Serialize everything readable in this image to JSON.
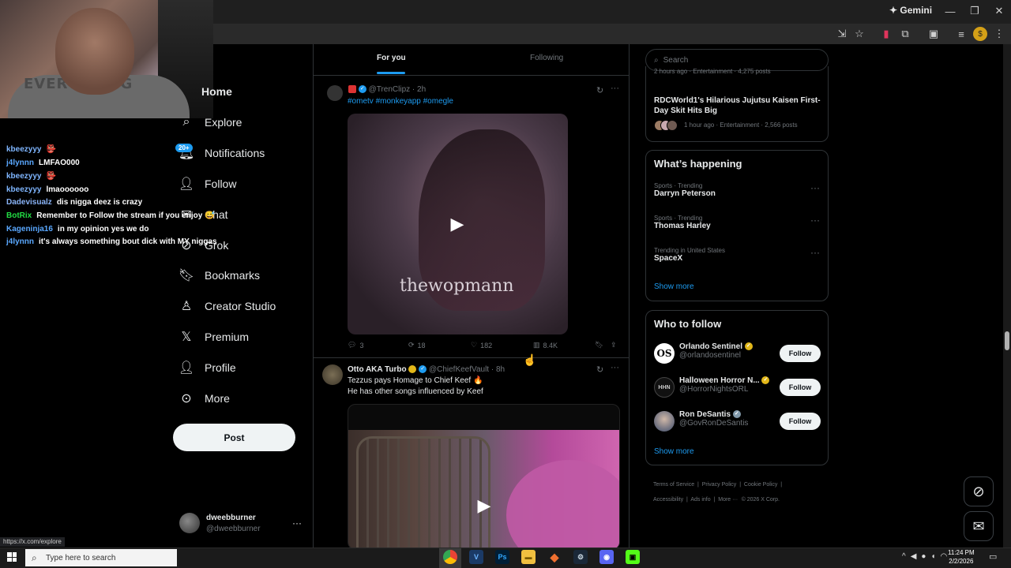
{
  "browser": {
    "gemini_label": "Gemini",
    "status_url": "https://x.com/explore"
  },
  "webcam": {
    "shirt_text": "EVERYTHING"
  },
  "chat": [
    {
      "user": "kbeezyyy",
      "color": "#7fb6ff",
      "message": "👺"
    },
    {
      "user": "j4lynnn",
      "color": "#5aa8ff",
      "message": "LMFAO000"
    },
    {
      "user": "kbeezyyy",
      "color": "#7fb6ff",
      "message": "👺"
    },
    {
      "user": "kbeezyyy",
      "color": "#7fb6ff",
      "message": "lmaoooooo"
    },
    {
      "user": "Dadevisualz",
      "color": "#8ab4f8",
      "message": "dis nigga deez is crazy"
    },
    {
      "user": "BotRix",
      "color": "#22dd44",
      "message": "Remember to Follow the stream if you enjoy 😅"
    },
    {
      "user": "Kageninja16",
      "color": "#5aa8ff",
      "message": "in my opinion yes we do"
    },
    {
      "user": "j4lynnn",
      "color": "#5aa8ff",
      "message": "it's always something bout dick with MY niggas"
    }
  ],
  "nav": {
    "home": "Home",
    "explore": "Explore",
    "notifications": "Notifications",
    "notifications_badge": "20+",
    "follow": "Follow",
    "chat": "Chat",
    "grok": "Grok",
    "bookmarks": "Bookmarks",
    "creator_studio": "Creator Studio",
    "premium": "Premium",
    "profile": "Profile",
    "more": "More",
    "post_button": "Post"
  },
  "account": {
    "name": "dweebburner",
    "handle": "@dweebburner",
    "more": "···"
  },
  "tabs": {
    "for_you": "For you",
    "following": "Following"
  },
  "post1": {
    "handle": "@TrenClipz",
    "time": "· 2h",
    "hashtags": "#ometv #monkeyapp #omegle",
    "watermark": "thewopmann",
    "replies": "3",
    "reposts": "18",
    "likes": "182",
    "views": "8.4K"
  },
  "post2": {
    "name": "Otto AKA Turbo",
    "handle": "@ChiefKeefVault",
    "time": "· 8h",
    "text_line1": "Tezzus pays Homage to Chief Keef 🔥",
    "text_line2": "He has other songs influenced by Keef"
  },
  "right": {
    "search_placeholder": "Search",
    "top_trend_meta": "2 hours ago · Entertainment · 4,275 posts",
    "news_title": "RDCWorld1's Hilarious Jujutsu Kaisen First-Day Skit Hits Big",
    "news_meta": "1 hour ago · Entertainment · 2,566 posts",
    "whats_happening_title": "What’s happening",
    "trends": [
      {
        "category": "Sports · Trending",
        "name": "Darryn Peterson"
      },
      {
        "category": "Sports · Trending",
        "name": "Thomas Harley"
      },
      {
        "category": "Trending in United States",
        "name": "SpaceX"
      }
    ],
    "trends_show_more": "Show more",
    "who_to_follow_title": "Who to follow",
    "who_to_follow": [
      {
        "name": "Orlando Sentinel",
        "handle": "@orlandosentinel",
        "avatar_text": "OS",
        "button": "Follow"
      },
      {
        "name": "Halloween Horror N...",
        "handle": "@HorrorNightsORL",
        "avatar_text": "HHN",
        "button": "Follow"
      },
      {
        "name": "Ron DeSantis",
        "handle": "@GovRonDeSantis",
        "avatar_text": "",
        "button": "Follow"
      }
    ],
    "wtf_show_more": "Show more",
    "footer": [
      "Terms of Service",
      "Privacy Policy",
      "Cookie Policy",
      "Accessibility",
      "Ads info",
      "More ···",
      "© 2026 X Corp."
    ]
  },
  "taskbar": {
    "search_placeholder": "Type here to search",
    "time": "11:24 PM",
    "date": "2/2/2026"
  }
}
